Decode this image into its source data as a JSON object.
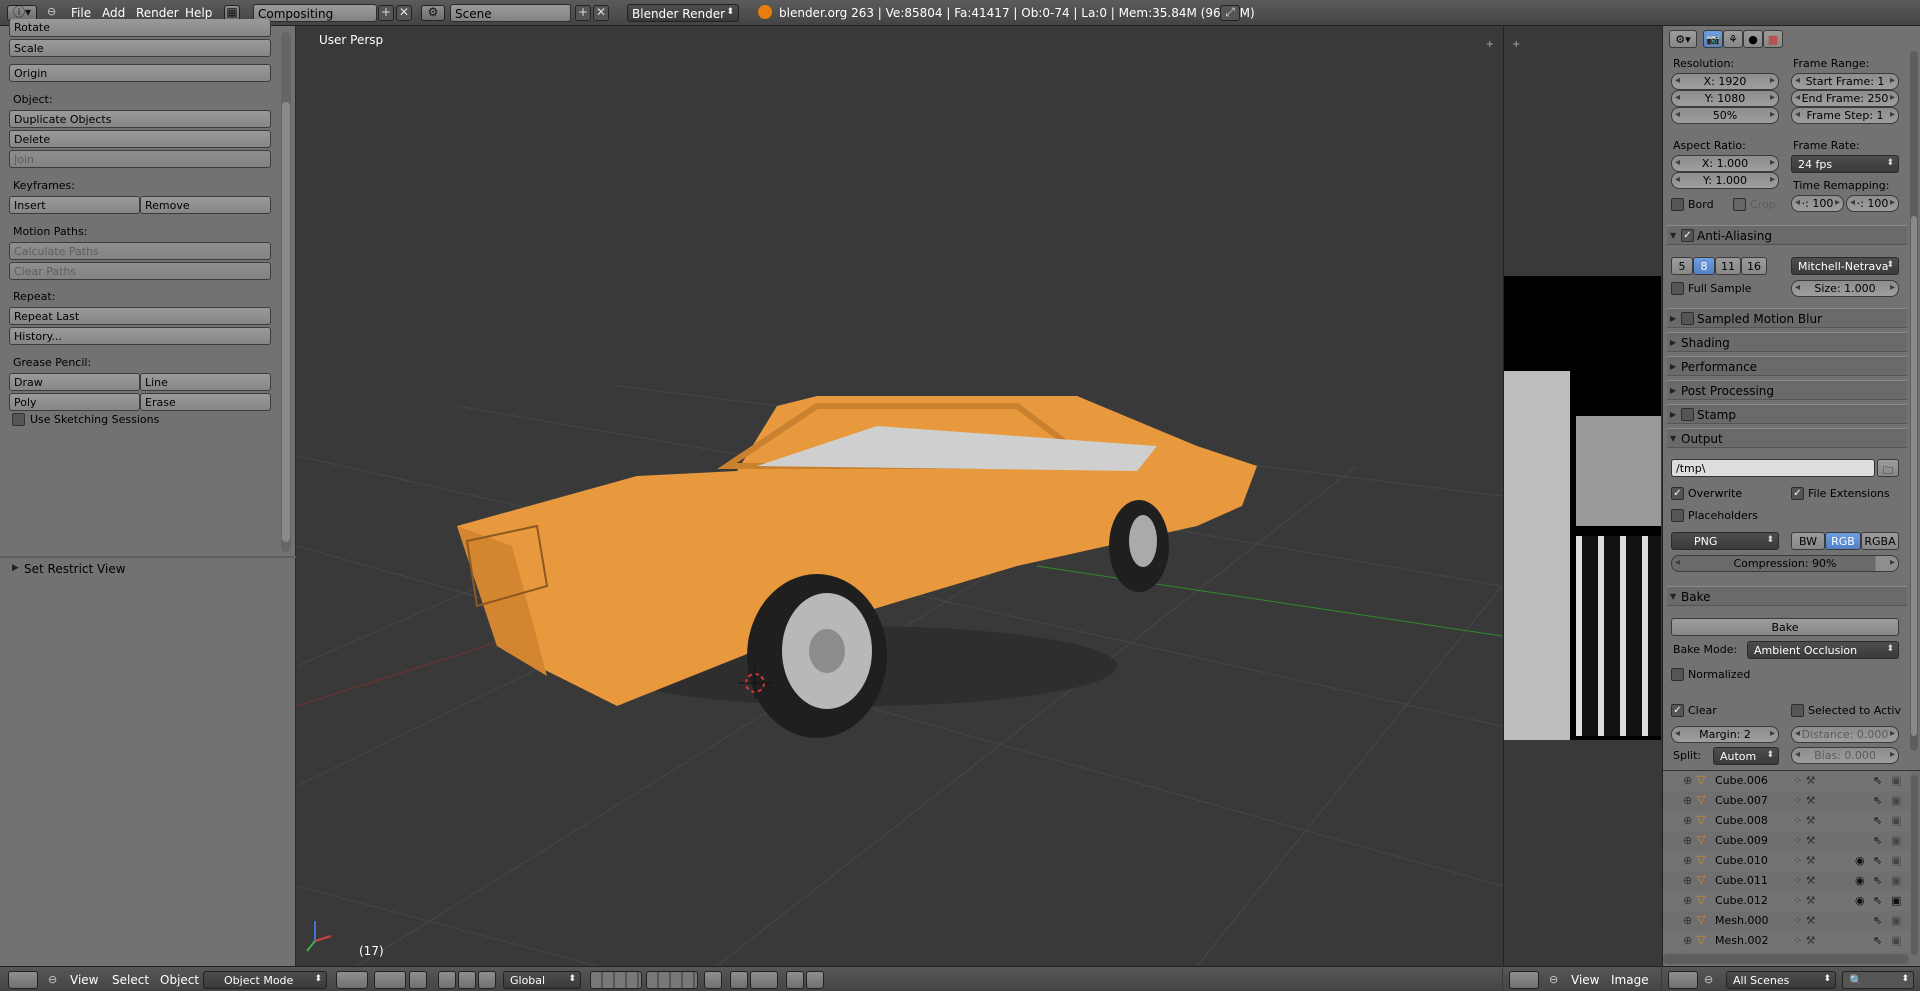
{
  "header": {
    "menus": [
      "File",
      "Add",
      "Render",
      "Help"
    ],
    "screen_layout": "Compositing",
    "scene": "Scene",
    "render_engine": "Blender Render",
    "stats": "blender.org 263 | Ve:85804 | Fa:41417 | Ob:0-74 | La:0 | Mem:35.84M (96.96M)"
  },
  "toolshelf": {
    "rotate": "Rotate",
    "scale": "Scale",
    "origin": "Origin",
    "object_label": "Object:",
    "duplicate": "Duplicate Objects",
    "delete": "Delete",
    "join": "Join",
    "keyframes_label": "Keyframes:",
    "insert": "Insert",
    "remove": "Remove",
    "motion_paths_label": "Motion Paths:",
    "calculate_paths": "Calculate Paths",
    "clear_paths": "Clear Paths",
    "repeat_label": "Repeat:",
    "repeat_last": "Repeat Last",
    "history": "History...",
    "grease_pencil_label": "Grease Pencil:",
    "draw": "Draw",
    "line": "Line",
    "poly": "Poly",
    "erase": "Erase",
    "use_sketching": "Use Sketching Sessions",
    "set_restrict_view": "Set Restrict View"
  },
  "viewport": {
    "title": "User Persp",
    "frame": "(17)",
    "car_color": "#e8993e"
  },
  "properties": {
    "resolution_label": "Resolution:",
    "res_x": "X: 1920",
    "res_y": "Y: 1080",
    "res_pct": "50%",
    "frame_range_label": "Frame Range:",
    "start_frame": "Start Frame: 1",
    "end_frame": "End Frame: 250",
    "frame_step": "Frame Step: 1",
    "aspect_label": "Aspect Ratio:",
    "aspect_x": "X: 1.000",
    "aspect_y": "Y: 1.000",
    "frame_rate_label": "Frame Rate:",
    "frame_rate": "24 fps",
    "time_remap_label": "Time Remapping:",
    "time_old": "·: 100",
    "time_new": "·: 100",
    "bord": "Bord",
    "crop": "Crop",
    "anti_aliasing": "Anti-Aliasing",
    "aa_samples": [
      "5",
      "8",
      "11",
      "16"
    ],
    "aa_filter": "Mitchell-Netrava",
    "full_sample": "Full Sample",
    "aa_size": "Size: 1.000",
    "panels": [
      "Sampled Motion Blur",
      "Shading",
      "Performance",
      "Post Processing",
      "Stamp",
      "Output"
    ],
    "output_path": "/tmp\\",
    "overwrite": "Overwrite",
    "file_extensions": "File Extensions",
    "placeholders": "Placeholders",
    "file_format": "PNG",
    "color_modes": [
      "BW",
      "RGB",
      "RGBA"
    ],
    "compression": "Compression: 90%",
    "bake_panel": "Bake",
    "bake_button": "Bake",
    "bake_mode_label": "Bake Mode:",
    "bake_mode": "Ambient Occlusion",
    "normalized": "Normalized",
    "clear": "Clear",
    "selected_to_active": "Selected to Activ",
    "margin": "Margin: 2",
    "distance": "Distance: 0.000",
    "split_label": "Split:",
    "split": "Autom",
    "bias": "Bias: 0.000"
  },
  "outliner": {
    "items": [
      "Cube.006",
      "Cube.007",
      "Cube.008",
      "Cube.009",
      "Cube.010",
      "Cube.011",
      "Cube.012",
      "Mesh.000",
      "Mesh.002"
    ]
  },
  "footer": {
    "view": "View",
    "select": "Select",
    "object": "Object",
    "mode": "Object Mode",
    "orientation": "Global",
    "uv_view": "View",
    "uv_image": "Image",
    "outliner_scope": "All Scenes"
  }
}
